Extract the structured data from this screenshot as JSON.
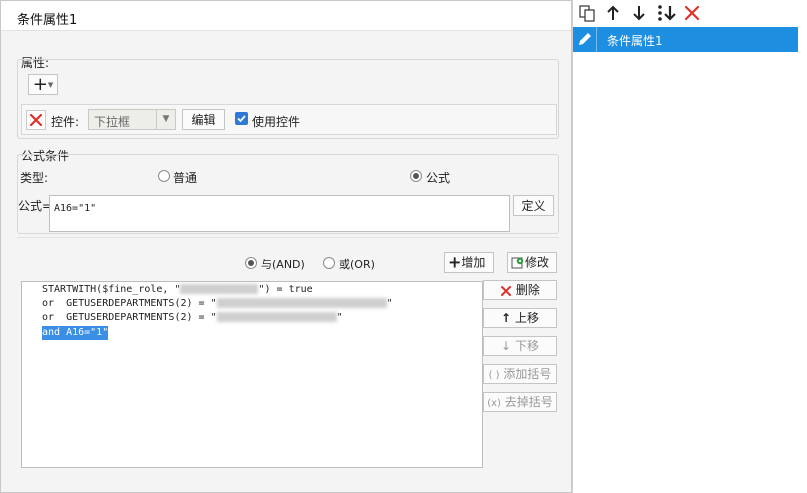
{
  "dialog": {
    "title": "条件属性1"
  },
  "properties": {
    "group_label": "属性:",
    "add_button": "+",
    "control_label": "控件:",
    "control_value": "下拉框",
    "edit_button": "编辑",
    "use_control_label": "使用控件",
    "use_control_checked": true
  },
  "formula_condition": {
    "group_label": "公式条件",
    "type_label": "类型:",
    "type_options": [
      "普通",
      "公式"
    ],
    "type_selected": "公式",
    "formula_label": "公式=",
    "formula_value": "A16=\"1\"",
    "define_button": "定义",
    "logic_and": "与(AND)",
    "logic_or": "或(OR)",
    "logic_selected": "与(AND)",
    "add_button": "增加",
    "modify_button": "修改",
    "code_lines": [
      {
        "before": "STARTWITH($fine_role, \"",
        "after": "\") = true"
      },
      {
        "before": "or  GETUSERDEPARTMENTS(2) = \"",
        "after": "\""
      },
      {
        "before": "or  GETUSERDEPARTMENTS(2) = \"",
        "after": "\""
      },
      {
        "before": "and A16=\"1\"",
        "after": ""
      }
    ],
    "side_buttons": {
      "delete": "删除",
      "move_up": "上移",
      "move_down": "下移",
      "add_bracket": "添加括号",
      "remove_bracket": "去掉括号"
    }
  },
  "right_panel": {
    "toolbar_icons": [
      "copy-icon",
      "arrow-up-icon",
      "arrow-down-icon",
      "move-bottom-icon",
      "delete-x-icon"
    ],
    "items": [
      {
        "label": "条件属性1",
        "selected": true
      }
    ]
  },
  "colors": {
    "accent": "#1e8ee0",
    "delete_red": "#e0302a",
    "selection": "#3a8ee6",
    "checkbox": "#2d7ad6",
    "modify_green": "#2e9a3e"
  }
}
